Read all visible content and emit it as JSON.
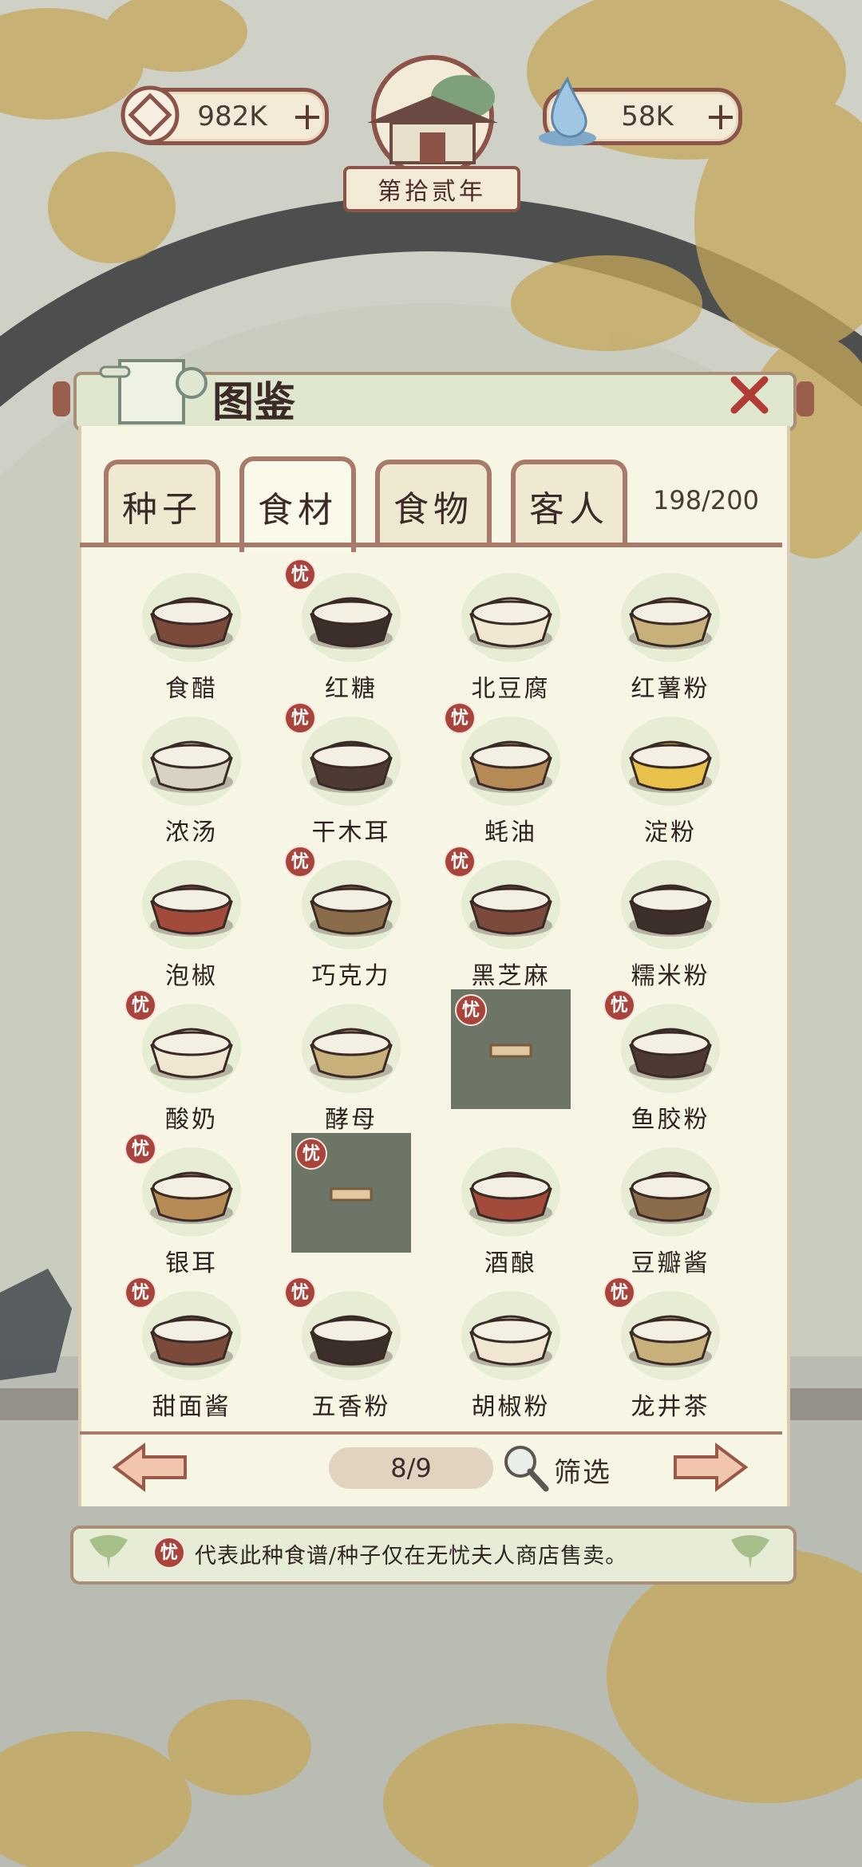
{
  "hud": {
    "coins": "982K",
    "gems": "58K",
    "year": "第拾贰年",
    "plus": "+"
  },
  "panel": {
    "title": "图鉴",
    "tabs": [
      {
        "label": "种子"
      },
      {
        "label": "食材"
      },
      {
        "label": "食物"
      },
      {
        "label": "客人"
      }
    ],
    "active_tab": 1,
    "count": "198/200"
  },
  "items": [
    {
      "name": "食醋",
      "exclusive": false
    },
    {
      "name": "红糖",
      "exclusive": true
    },
    {
      "name": "北豆腐",
      "exclusive": false
    },
    {
      "name": "红薯粉",
      "exclusive": false
    },
    {
      "name": "浓汤",
      "exclusive": false
    },
    {
      "name": "干木耳",
      "exclusive": true
    },
    {
      "name": "蚝油",
      "exclusive": true
    },
    {
      "name": "淀粉",
      "exclusive": false
    },
    {
      "name": "泡椒",
      "exclusive": false
    },
    {
      "name": "巧克力",
      "exclusive": true
    },
    {
      "name": "黑芝麻",
      "exclusive": true
    },
    {
      "name": "糯米粉",
      "exclusive": false
    },
    {
      "name": "酸奶",
      "exclusive": true
    },
    {
      "name": "酵母",
      "exclusive": false
    },
    {
      "name": "",
      "exclusive": true,
      "locked": true
    },
    {
      "name": "鱼胶粉",
      "exclusive": true
    },
    {
      "name": "银耳",
      "exclusive": true
    },
    {
      "name": "",
      "exclusive": true,
      "locked": true
    },
    {
      "name": "酒酿",
      "exclusive": false
    },
    {
      "name": "豆瓣酱",
      "exclusive": false
    },
    {
      "name": "甜面酱",
      "exclusive": true
    },
    {
      "name": "五香粉",
      "exclusive": true
    },
    {
      "name": "胡椒粉",
      "exclusive": false
    },
    {
      "name": "龙井茶",
      "exclusive": true
    }
  ],
  "badge_char": "忧",
  "pager": {
    "page": "8/9",
    "filter_label": "筛选"
  },
  "note": "代表此种食谱/种子仅在无忧夫人商店售卖。",
  "colors": {
    "frame": "#a87a6a",
    "panel": "#f7f5e3",
    "badge": "#a8443c"
  }
}
